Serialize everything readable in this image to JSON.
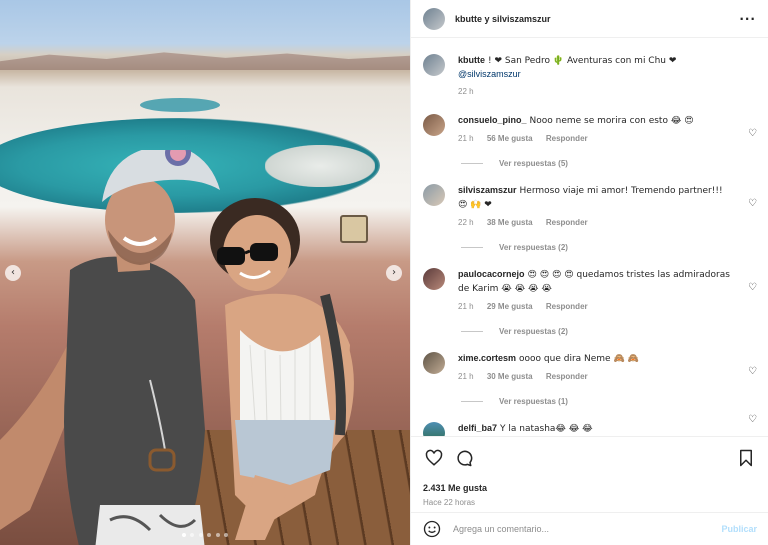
{
  "header": {
    "names": "kbutte y silviszamszur",
    "more_icon": "ellipsis-icon",
    "more_glyph": "···"
  },
  "caption": {
    "user": "kbutte",
    "text": "! ❤ San Pedro 🌵 Aventuras con mi Chu ❤",
    "mention": "@silviszamszur",
    "time": "22 h"
  },
  "comments": [
    {
      "user": "consuelo_pino_",
      "text": "Nooo neme se morira con esto 😂 😍",
      "time": "21 h",
      "likes": "56 Me gusta",
      "reply": "Responder",
      "view_replies": "Ver respuestas (5)"
    },
    {
      "user": "silviszamszur",
      "text": "Hermoso viaje mi amor! Tremendo partner!!! 😍 🙌 ❤",
      "time": "22 h",
      "likes": "38 Me gusta",
      "reply": "Responder",
      "view_replies": "Ver respuestas (2)"
    },
    {
      "user": "paulocacornejo",
      "text": "😍 😍 😍 😍 quedamos tristes las admiradoras de Karim 😭 😭 😭 😭",
      "time": "21 h",
      "likes": "29 Me gusta",
      "reply": "Responder",
      "view_replies": "Ver respuestas (2)"
    },
    {
      "user": "xime.cortesm",
      "text": "oooo que dira Neme 🙈 🙈",
      "time": "21 h",
      "likes": "30 Me gusta",
      "reply": "Responder",
      "view_replies": "Ver respuestas (1)"
    },
    {
      "user": "delfi_ba7",
      "text": "Y la natasha😂 😂 😂",
      "time": "",
      "likes": "",
      "reply": "",
      "view_replies": ""
    }
  ],
  "actions": {
    "like_icon": "heart-icon",
    "comment_icon": "comment-icon",
    "save_icon": "bookmark-icon",
    "likes_count": "2.431 Me gusta",
    "posted_ago": "Hace 22 horas"
  },
  "composer": {
    "placeholder": "Agrega un comentario...",
    "post_label": "Publicar",
    "emoji_icon": "smiley-icon"
  },
  "photo": {
    "nav_prev": "‹",
    "nav_next": "›"
  },
  "colors": {
    "post_button": "#b2dffc",
    "meta_gray": "#8e8e8e",
    "text": "#262626"
  }
}
